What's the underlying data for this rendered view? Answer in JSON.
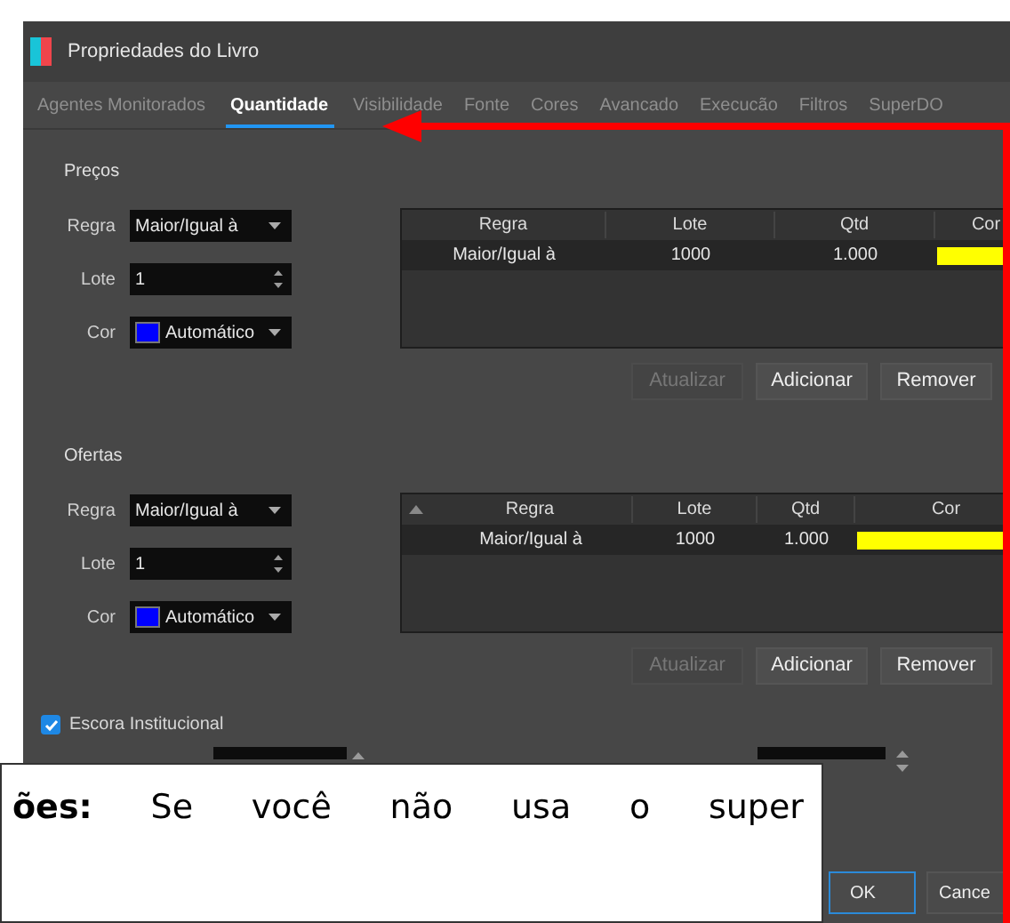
{
  "window": {
    "title": "Propriedades do Livro"
  },
  "tabs": [
    {
      "label": "Agentes Monitorados",
      "selected": false
    },
    {
      "label": "Quantidade",
      "selected": true
    },
    {
      "label": "Visibilidade",
      "selected": false
    },
    {
      "label": "Fonte",
      "selected": false
    },
    {
      "label": "Cores",
      "selected": false
    },
    {
      "label": "Avancado",
      "selected": false
    },
    {
      "label": "Execucão",
      "selected": false
    },
    {
      "label": "Filtros",
      "selected": false
    },
    {
      "label": "SuperDO",
      "selected": false
    }
  ],
  "sections": [
    {
      "title": "Preços",
      "rule_label": "Regra",
      "rule_value": "Maior/Igual à",
      "lot_label": "Lote",
      "lot_value": "1",
      "color_label": "Cor",
      "color_value": "Automático",
      "color": "#0000ff",
      "table": {
        "sorted": false,
        "columns": [
          "Regra",
          "Lote",
          "Qtd",
          "Cor"
        ],
        "rows": [
          {
            "rule": "Maior/Igual à",
            "lot": "1000",
            "qty": "1.000",
            "color": "#ffff00"
          }
        ]
      },
      "buttons": [
        {
          "label": "Atualizar",
          "disabled": true
        },
        {
          "label": "Adicionar",
          "disabled": false
        },
        {
          "label": "Remover",
          "disabled": false
        }
      ]
    },
    {
      "title": "Ofertas",
      "rule_label": "Regra",
      "rule_value": "Maior/Igual à",
      "lot_label": "Lote",
      "lot_value": "1",
      "color_label": "Cor",
      "color_value": "Automático",
      "color": "#0000ff",
      "table": {
        "sorted": true,
        "columns": [
          "Regra",
          "Lote",
          "Qtd",
          "Cor"
        ],
        "rows": [
          {
            "rule": "Maior/Igual à",
            "lot": "1000",
            "qty": "1.000",
            "color": "#ffff00"
          }
        ]
      },
      "buttons": [
        {
          "label": "Atualizar",
          "disabled": true
        },
        {
          "label": "Adicionar",
          "disabled": false
        },
        {
          "label": "Remover",
          "disabled": false
        }
      ]
    }
  ],
  "escora": {
    "label": "Escora Institucional",
    "checked": true
  },
  "dialog_buttons": [
    {
      "label": "OK",
      "focused": true
    },
    {
      "label": "Cance",
      "focused": false
    }
  ],
  "caption": {
    "text": "**ões:** Se você não usa o super"
  }
}
